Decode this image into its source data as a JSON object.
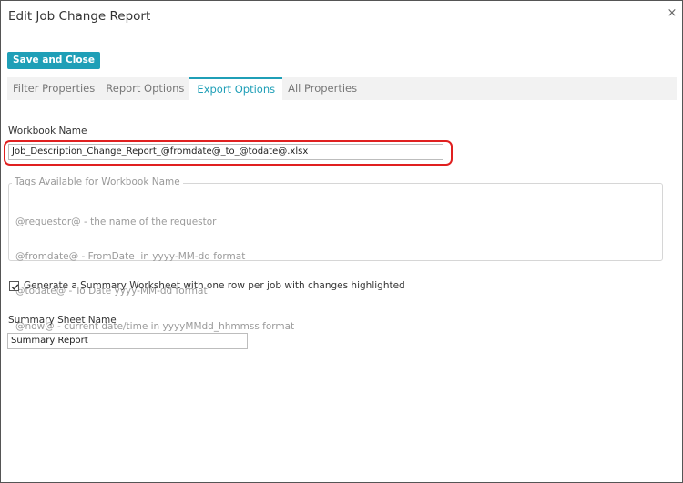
{
  "dialog": {
    "title": "Edit Job Change Report",
    "close_glyph": "×"
  },
  "toolbar": {
    "save_close_label": "Save and Close"
  },
  "tabs": [
    {
      "label": "Filter Properties",
      "active": false
    },
    {
      "label": "Report Options",
      "active": false
    },
    {
      "label": "Export Options",
      "active": true
    },
    {
      "label": "All Properties",
      "active": false
    }
  ],
  "workbook": {
    "label": "Workbook Name",
    "value": "Job_Description_Change_Report_@fromdate@_to_@todate@.xlsx"
  },
  "tags": {
    "legend": "Tags Available for Workbook Name",
    "lines": [
      "@requestor@ - the name of the requestor",
      "@fromdate@ - FromDate  in yyyy-MM-dd format",
      "@todate@ - To Date yyyy-MM-dd format",
      "@now@ - current date/time in yyyyMMdd_hhmmss format"
    ]
  },
  "summary": {
    "checkbox_checked": true,
    "checkbox_label": "Generate a Summary Worksheet with one row per job with changes highlighted",
    "sheet_label": "Summary Sheet Name",
    "sheet_value": "Summary Report"
  },
  "colors": {
    "accent": "#1f9fb7",
    "highlight": "#e02020"
  }
}
